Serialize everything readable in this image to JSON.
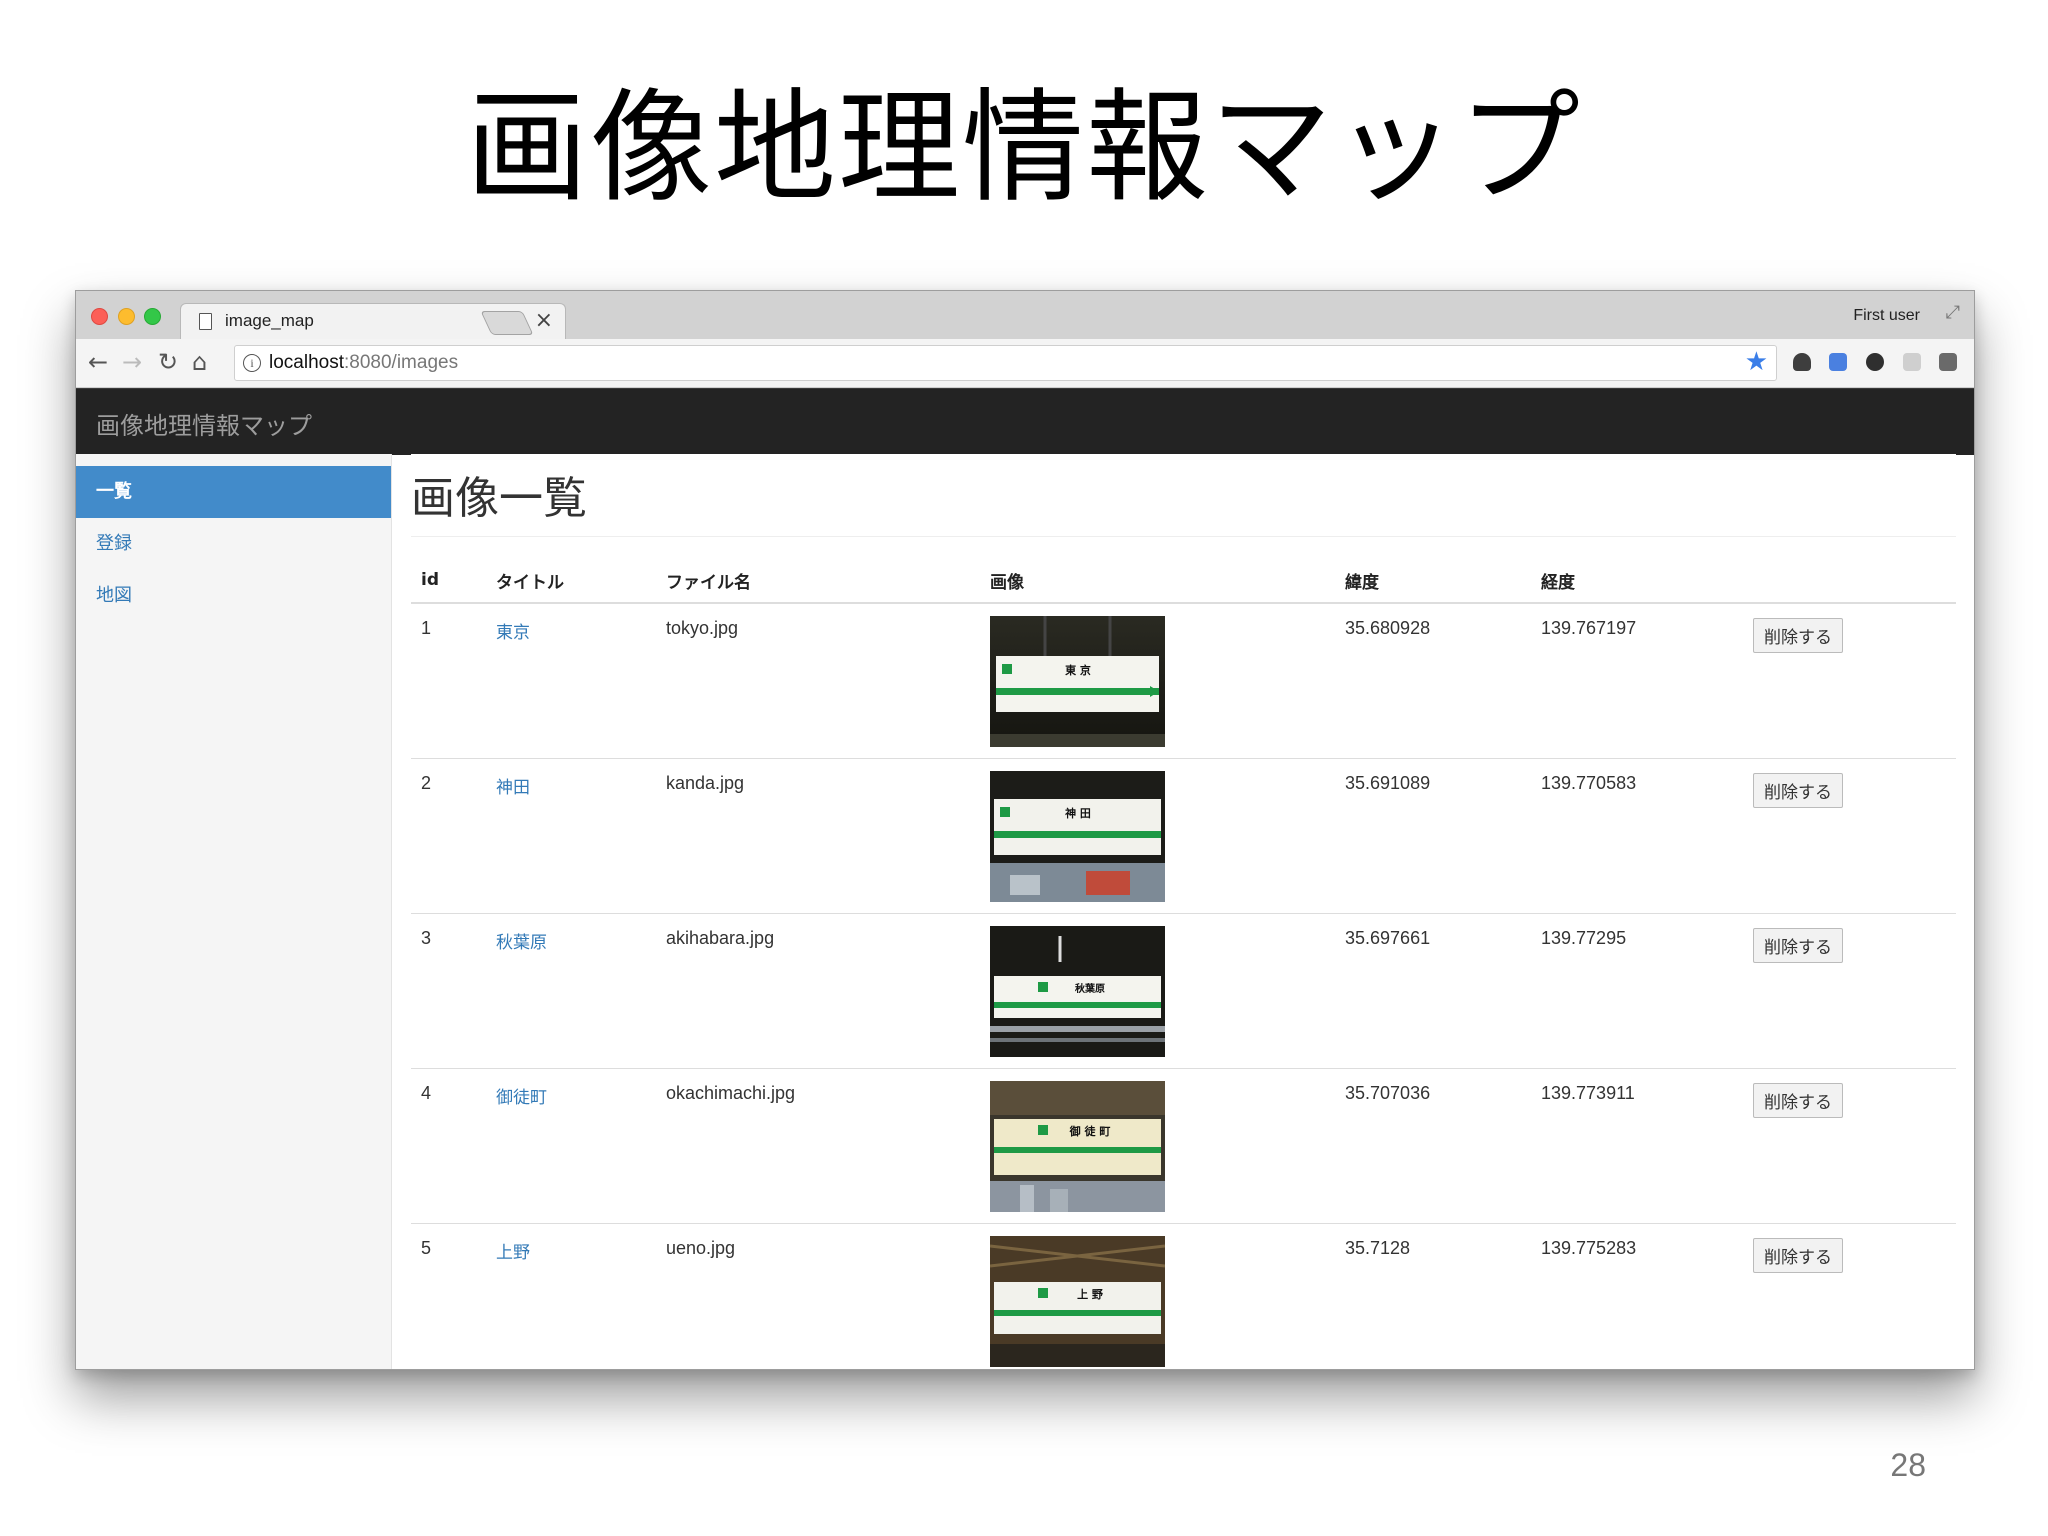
{
  "slide": {
    "title": "画像地理情報マップ",
    "page_number": "28"
  },
  "browser": {
    "tab_title": "image_map",
    "tab_close": "×",
    "user": "First user",
    "url_host": "localhost",
    "url_rest": ":8080/images"
  },
  "app": {
    "brand": "画像地理情報マップ",
    "sidebar": [
      {
        "label": "一覧",
        "active": true
      },
      {
        "label": "登録",
        "active": false
      },
      {
        "label": "地図",
        "active": false
      }
    ],
    "page_title": "画像一覧"
  },
  "table": {
    "headers": [
      "id",
      "タイトル",
      "ファイル名",
      "画像",
      "緯度",
      "経度",
      ""
    ],
    "rows": [
      {
        "id": "1",
        "title": "東京",
        "file": "tokyo.jpg",
        "lat": "35.680928",
        "lng": "139.767197",
        "delete": "削除する",
        "sign_text": "東 京"
      },
      {
        "id": "2",
        "title": "神田",
        "file": "kanda.jpg",
        "lat": "35.691089",
        "lng": "139.770583",
        "delete": "削除する",
        "sign_text": "神 田"
      },
      {
        "id": "3",
        "title": "秋葉原",
        "file": "akihabara.jpg",
        "lat": "35.697661",
        "lng": "139.77295",
        "delete": "削除する",
        "sign_text": "秋葉原"
      },
      {
        "id": "4",
        "title": "御徒町",
        "file": "okachimachi.jpg",
        "lat": "35.707036",
        "lng": "139.773911",
        "delete": "削除する",
        "sign_text": "御 徒 町"
      },
      {
        "id": "5",
        "title": "上野",
        "file": "ueno.jpg",
        "lat": "35.7128",
        "lng": "139.775283",
        "delete": "削除する",
        "sign_text": "上 野"
      }
    ]
  },
  "colors": {
    "navbar": "#232323",
    "active_nav": "#428bca",
    "link": "#337ab7",
    "sign_green": "#1e9a45",
    "bookmark_star": "#3a7ee8"
  }
}
